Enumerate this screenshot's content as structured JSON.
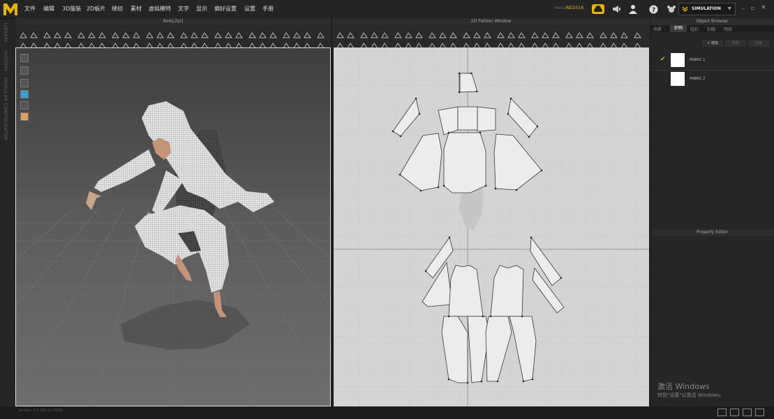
{
  "menu": [
    "文件",
    "编辑",
    "3D服装",
    "2D板片",
    "缝纫",
    "素材",
    "虚拟模特",
    "文字",
    "显示",
    "偏好设置",
    "设置",
    "手册"
  ],
  "account": {
    "prefix": "Hello,",
    "user": "iND2018"
  },
  "mode": {
    "label": "SIMULATION"
  },
  "left_strip": {
    "items": [
      "LIBRARY",
      "HISTORY",
      "MODULAR CONFIGURATOR"
    ]
  },
  "panel3d": {
    "title": "Body.Zprj"
  },
  "panel2d": {
    "title": "2D Pattern Window"
  },
  "object_browser": {
    "title": "Object Browser",
    "tabs": [
      "场景",
      "织物",
      "纽扣",
      "扣眼",
      "明线"
    ],
    "active_tab": 1,
    "actions": {
      "add": "+ 增加",
      "copy": "复制",
      "apply": "应用"
    },
    "fabrics": [
      {
        "name": "FABRIC 1",
        "checked": true
      },
      {
        "name": "FABRIC 2",
        "checked": false
      }
    ]
  },
  "property_editor": {
    "title": "Property Editor"
  },
  "watermark": {
    "line1": "激活 Windows",
    "line2": "转到\"设置\"以激活 Windows。"
  },
  "status": {
    "version": "Version: 4.2.265 (r17638)"
  },
  "colors": {
    "accent": "#e8b400",
    "viewport_bg": "#5a5a5a",
    "pattern_bg": "#d4d4d4"
  }
}
